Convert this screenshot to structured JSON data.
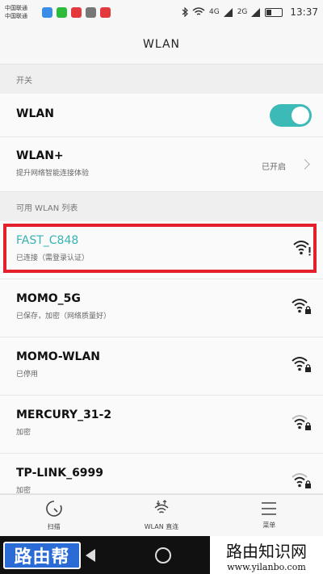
{
  "status_bar": {
    "carrier1": "中国联通",
    "carrier2": "中国联通",
    "net4g": "4G",
    "net2g": "2G",
    "time": "13:37"
  },
  "app_bar": {
    "title": "WLAN"
  },
  "switch_section": {
    "header": "开关"
  },
  "wlan_toggle": {
    "label": "WLAN",
    "state": "on",
    "accent": "#3cbab8"
  },
  "wlan_plus": {
    "title": "WLAN+",
    "subtitle": "提升网络智能连接体验",
    "status": "已开启"
  },
  "available": {
    "header": "可用 WLAN 列表"
  },
  "networks": [
    {
      "name": "FAST_C848",
      "status": "已连接（需登录认证）",
      "icon": "wifi-alert-icon",
      "connected": true
    },
    {
      "name": "MOMO_5G",
      "status": "已保存，加密（网络质量好）",
      "icon": "wifi-lock-icon"
    },
    {
      "name": "MOMO-WLAN",
      "status": "已停用",
      "icon": "wifi-lock-icon"
    },
    {
      "name": "MERCURY_31-2",
      "status": "加密",
      "icon": "wifi-lock-icon"
    },
    {
      "name": "TP-LINK_6999",
      "status": "加密",
      "icon": "wifi-lock-icon"
    }
  ],
  "bottom_nav": [
    {
      "label": "扫描",
      "icon": "refresh-icon"
    },
    {
      "label": "WLAN 直连",
      "icon": "wifi-direct-icon"
    },
    {
      "label": "菜单",
      "icon": "menu-icon"
    }
  ],
  "watermark": {
    "logo_text": "路由帮",
    "title": "路由知识网",
    "url": "www.yilanbo.com"
  },
  "colors": {
    "accent": "#36b3b1",
    "highlight": "#e3202c"
  }
}
